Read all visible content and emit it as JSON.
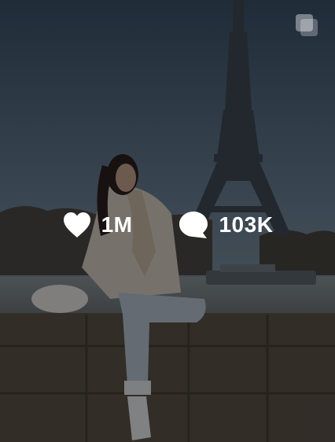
{
  "post": {
    "likes_count": "1M",
    "comments_count": "103K",
    "icons": {
      "likes": "heart-icon",
      "comments": "comment-icon",
      "multiple_media": "carousel-icon"
    },
    "overlay_color": "#000000"
  }
}
